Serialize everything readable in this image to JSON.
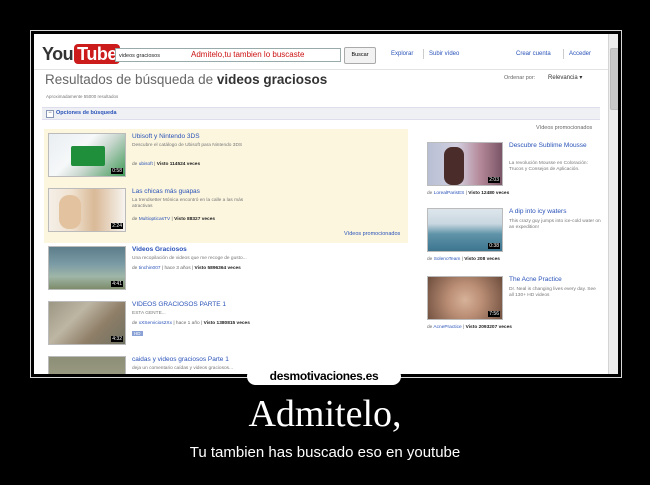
{
  "youtube": {
    "logo_you": "You",
    "logo_tube": "Tube",
    "search_value": "videos graciosos",
    "search_overlay": "Admitelo,tu tambien lo buscaste",
    "search_button": "Buscar",
    "nav": [
      "Explorar",
      "Subir vídeo"
    ],
    "account": [
      "Crear cuenta",
      "Acceder"
    ],
    "results_title_prefix": "Resultados de búsqueda de",
    "results_title_query": "videos graciosos",
    "sort_label": "Ordenar por:",
    "sort_value": "Relevancia ▾",
    "approx_results": "Aproximadamente 55000 resultados",
    "options_label": "Opciones de búsqueda",
    "options_toggle": "−",
    "promoted_link": "Vídeos promocionados",
    "results": [
      {
        "title": "Ubisoft y Nintendo 3DS",
        "desc": "Descubre el catálogo de Ubisoft para Nintendo 3DS",
        "by_prefix": "de",
        "by": "ubisoft",
        "views": "Visto 114524 veces",
        "duration": "0:58"
      },
      {
        "title": "Las chicas más guapas",
        "desc": "La trendsetter Mónica encontró en la calle a las más atractivas",
        "by_prefix": "de",
        "by": "MultiopticasTV",
        "views": "Visto 88327 veces",
        "duration": "2:24"
      },
      {
        "title": "Videos Graciosos",
        "desc": "Una recopilación de videos que me recoge de gusto...",
        "by_prefix": "de",
        "by": "tinchin007",
        "ago": " | hace 3 años | ",
        "views": "Visto 5896364 veces",
        "duration": "4:41"
      },
      {
        "title": "VIDEOS GRACIOSOS PARTE 1",
        "desc": "ESTA GENTE...",
        "by_prefix": "de",
        "by": "xXServicios2Xx",
        "ago": " | hace 1 año | ",
        "views": "Visto 1380815 veces",
        "duration": "4:32",
        "badge": "HD"
      },
      {
        "title": "caidas y videos graciosos Parte 1",
        "desc": "deja un comentario caídas y videos graciosos..."
      }
    ],
    "promoted_header": "Vídeos promocionados",
    "promoted": [
      {
        "title": "Descubre Sublime Mousse",
        "desc": "La revolución Mousse en Coloración: Trucos y Consejos de Aplicación.",
        "by_prefix": "de",
        "by": "LorealParisES",
        "views": "Visto 12480 veces",
        "duration": "2:03"
      },
      {
        "title": "A dip into icy waters",
        "desc": "This crazy guy jumps into ice-cold water on an expedition!",
        "by_prefix": "de",
        "by": "SolenoTeam",
        "views": "Visto 208 veces",
        "duration": "0:38"
      },
      {
        "title": "The Acne Practice",
        "desc": "Dr. Neal is changing lives every day. See all 130+ HD videos",
        "by_prefix": "de",
        "by": "AcnePractice",
        "views": "Visto 2093207 veces",
        "duration": "7:56"
      }
    ]
  },
  "watermark": "desmotivaciones.es",
  "caption": "Admitelo,",
  "subcaption": "Tu tambien has buscado eso en youtube"
}
